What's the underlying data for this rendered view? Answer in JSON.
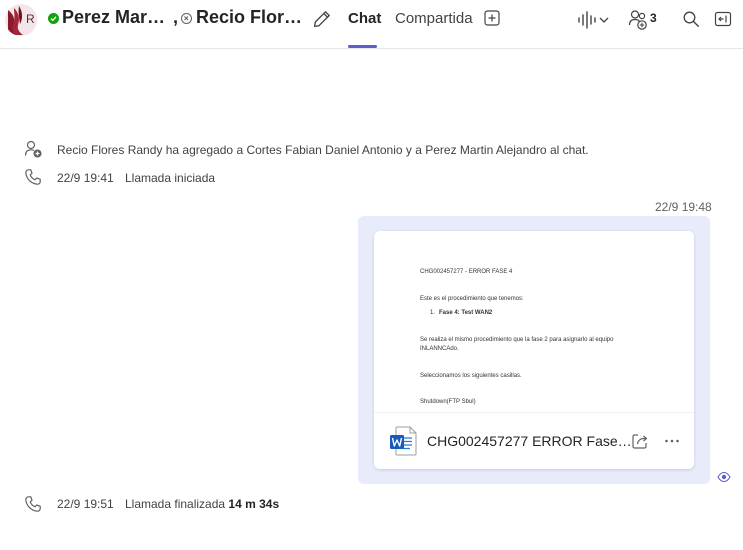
{
  "header": {
    "avatar_initial": "R",
    "participant1_name": "Perez Mar…",
    "separator": ",",
    "participant2_name": "Recio Flor…",
    "tabs": [
      {
        "label": "Chat",
        "active": true
      },
      {
        "label": "Compartida",
        "active": false
      }
    ],
    "participants_count": "3",
    "accent_color": "#5b5fc7",
    "presence_available_color": "#13a10e"
  },
  "events": [
    {
      "icon": "people-add-icon",
      "text": "Recio Flores Randy ha agregado a Cortes Fabian Daniel Antonio y a Perez Martin Alejandro al chat."
    },
    {
      "icon": "phone-icon",
      "time": "22/9 19:41",
      "text": "Llamada iniciada"
    },
    {
      "icon": "phone-icon",
      "time": "22/9 19:51",
      "text": "Llamada finalizada",
      "duration": "14 m 34s"
    }
  ],
  "message": {
    "timestamp": "22/9 19:48",
    "bubble_color": "#e8ebfa",
    "attachment": {
      "file_name": "CHG002457277 ERROR Fase…",
      "file_icon": "word-doc-icon",
      "preview": {
        "title": "CHG002457277 - ERROR FASE 4",
        "line1": "Este es el procedimiento que tenemos:",
        "list_number": "1.",
        "list_item": "Fase 4: Test WAN2",
        "line2a": "Se realiza el mismo procedimiento que la fase 2 para asignarlo al equipo",
        "line2b": "INLANNCAdo.",
        "line3": "Seleccionamos los siguientes casillas.",
        "line4": "Shutdown(FTP Sbul)"
      }
    }
  }
}
